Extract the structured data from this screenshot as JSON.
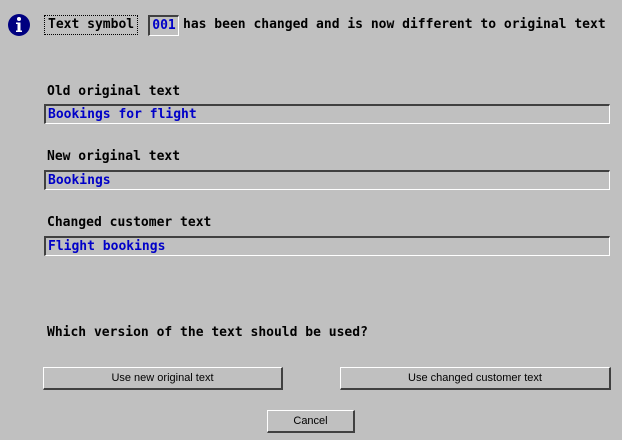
{
  "header": {
    "field_label": "Text symbol",
    "symbol_value": "001",
    "message": "has been changed and is now different to original text"
  },
  "fields": {
    "old_original": {
      "label": "Old original text",
      "value": "Bookings for flight"
    },
    "new_original": {
      "label": "New original text",
      "value": "Bookings"
    },
    "changed_customer": {
      "label": "Changed customer text",
      "value": "Flight bookings"
    }
  },
  "question": "Which version of the text should be used?",
  "buttons": {
    "use_new_original": "Use new original text",
    "use_changed_customer": "Use changed customer text",
    "cancel": "Cancel"
  },
  "icon": {
    "name": "info-icon",
    "color": "#000080"
  }
}
